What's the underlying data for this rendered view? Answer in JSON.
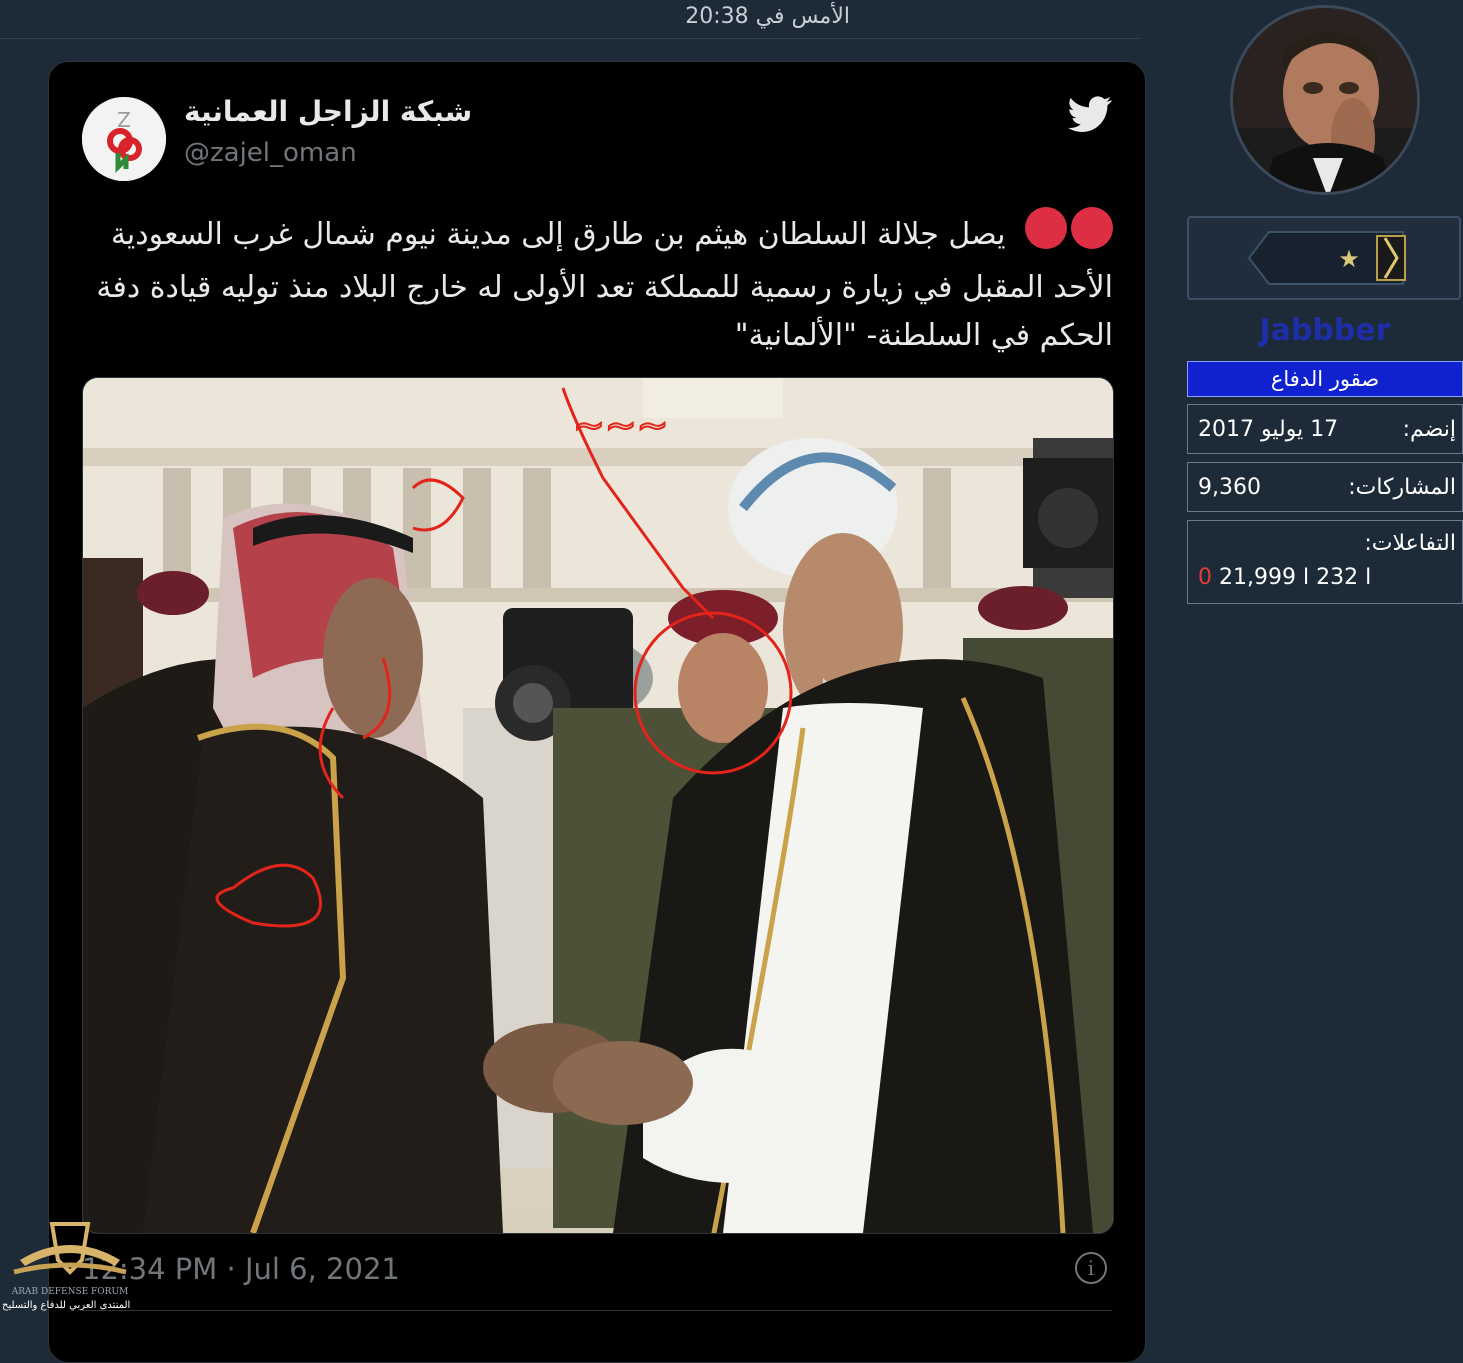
{
  "post": {
    "timestamp": "الأمس في 20:38"
  },
  "tweet": {
    "display_name": "شبكة الزاجل العمانية",
    "handle": "@zajel_oman",
    "text": "يصل جلالة السلطان هيثم بن طارق إلى مدينة نيوم شمال غرب السعودية الأحد المقبل في زيارة رسمية للمملكة تعد الأولى له خارج البلاد منذ توليه قيادة دفة الحكم في السلطنة- \"الألمانية\"",
    "time": "12:34 PM · Jul 6, 2021",
    "info_icon": "info-icon",
    "logo_icon": "twitter-bird-icon"
  },
  "watermark": {
    "text": "المنتدى العربي للدفاع والتسليح"
  },
  "user": {
    "username": "Jabbber",
    "title": "صقور الدفاع",
    "rank_icon": "star-rank-icon",
    "joined_label": "إنضم:",
    "joined_value": "17 يوليو 2017",
    "posts_label": "المشاركات:",
    "posts_value": "9,360",
    "reactions_label": "التفاعلات:",
    "reactions": [
      "21,999",
      "232",
      "0"
    ]
  },
  "colors": {
    "page_bg": "#1d2a38",
    "tweet_bg": "#000000",
    "accent_red": "#dd2e44",
    "username_color": "#1d2ea8",
    "title_bg": "#1021d0"
  }
}
